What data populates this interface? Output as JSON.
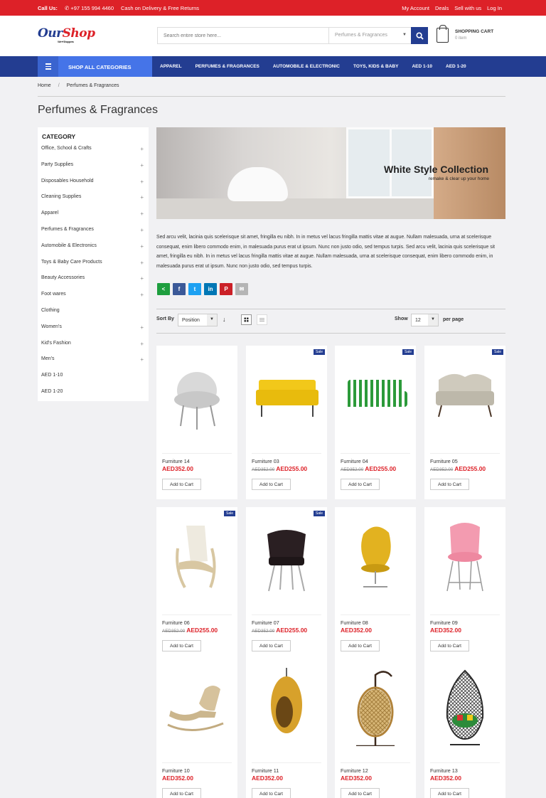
{
  "topbar": {
    "call_label": "Call Us:",
    "phone": "+97 155 994 4460",
    "promo": "Cash on Delivery & Free Returns",
    "links": [
      "My Account",
      "Deals",
      "Sell with us",
      "Log In"
    ]
  },
  "logo": {
    "brand_a": "Our",
    "brand_b": "Shop",
    "tagline": "We ♥ Shoppers"
  },
  "search": {
    "placeholder": "Search entire store here...",
    "category": "Perfumes & Fragrances"
  },
  "cart": {
    "title": "SHOPPING CART",
    "count": "0 item"
  },
  "nav": {
    "all_label": "SHOP ALL CATEGORIES",
    "items": [
      "APPAREL",
      "PERFUMES & FRAGRANCES",
      "AUTOMOBILE & ELECTRONIC",
      "TOYS, KIDS & BABY",
      "AED 1-10",
      "AED 1-20"
    ]
  },
  "breadcrumb": {
    "home": "Home",
    "sep": "/",
    "current": "Perfumes & Fragrances"
  },
  "page_title": "Perfumes & Fragrances",
  "sidebar": {
    "title": "CATEGORY",
    "items": [
      {
        "label": "Office, School & Crafts",
        "plus": "+"
      },
      {
        "label": "Party Supplies",
        "plus": "+"
      },
      {
        "label": "Disposables Household",
        "plus": "+"
      },
      {
        "label": "Cleaning Supplies",
        "plus": "+"
      },
      {
        "label": "Apparel",
        "plus": "+"
      },
      {
        "label": "Perfumes & Fragrances",
        "plus": "+"
      },
      {
        "label": "Automobile & Electronics",
        "plus": "+"
      },
      {
        "label": "Toys & Baby Care Products",
        "plus": "+"
      },
      {
        "label": "Beauty Accessories",
        "plus": "+"
      },
      {
        "label": "Foot wares",
        "plus": "+"
      },
      {
        "label": "Clothing",
        "plus": ""
      },
      {
        "label": "Women's",
        "plus": "+"
      },
      {
        "label": "Kid's Fashion",
        "plus": "+"
      },
      {
        "label": "Men's",
        "plus": "+"
      },
      {
        "label": "AED 1-10",
        "plus": ""
      },
      {
        "label": "AED 1-20",
        "plus": ""
      }
    ]
  },
  "banner": {
    "heading": "White Style Collection",
    "sub": "remake & clear up your home"
  },
  "description": "Sed arcu velit, lacinia quis scelerisque sit amet, fringilla eu nibh. In in metus vel lacus fringilla mattis vitae at augue. Nullam malesuada, urna at scelerisque consequat, enim libero commodo enim, in malesuada purus erat ut ipsum. Nunc non justo odio, sed tempus turpis. Sed arcu velit, lacinia quis scelerisque sit amet, fringilla eu nibh. In in metus vel lacus fringilla mattis vitae at augue. Nullam malesuada, urna at scelerisque consequat, enim libero commodo enim, in malesuada purus erat ut ipsum. Nunc non justo odio, sed tempus turpis.",
  "share": [
    {
      "icon": "share-icon",
      "glyph": "<",
      "color": "#1e9e3e"
    },
    {
      "icon": "facebook-icon",
      "glyph": "f",
      "color": "#3b5998"
    },
    {
      "icon": "twitter-icon",
      "glyph": "t",
      "color": "#1da1f2"
    },
    {
      "icon": "linkedin-icon",
      "glyph": "in",
      "color": "#0077b5"
    },
    {
      "icon": "pinterest-icon",
      "glyph": "P",
      "color": "#cb2027"
    },
    {
      "icon": "email-icon",
      "glyph": "✉",
      "color": "#b5b5b5"
    }
  ],
  "toolbar": {
    "sort_label": "Sort By",
    "sort_value": "Position",
    "show_label": "Show",
    "show_value": "12",
    "per_page": "per page"
  },
  "add_to_cart": "Add to Cart",
  "sale_label": "Sale",
  "products": [
    {
      "name": "Furniture 14",
      "old": "",
      "price": "AED352.00",
      "sale": false,
      "kind": "armchair-grey"
    },
    {
      "name": "Furniture 03",
      "old": "AED352.00",
      "price": "AED255.00",
      "sale": true,
      "kind": "sofa-yellow"
    },
    {
      "name": "Furniture 04",
      "old": "AED352.00",
      "price": "AED255.00",
      "sale": true,
      "kind": "sofa-striped"
    },
    {
      "name": "Furniture 05",
      "old": "AED352.00",
      "price": "AED255.00",
      "sale": true,
      "kind": "sofa-beige"
    },
    {
      "name": "Furniture 06",
      "old": "AED352.00",
      "price": "AED255.00",
      "sale": true,
      "kind": "lounge-chair"
    },
    {
      "name": "Furniture 07",
      "old": "AED352.00",
      "price": "AED255.00",
      "sale": true,
      "kind": "chair-black"
    },
    {
      "name": "Furniture 08",
      "old": "",
      "price": "AED352.00",
      "sale": false,
      "kind": "egg-chair"
    },
    {
      "name": "Furniture 09",
      "old": "",
      "price": "AED352.00",
      "sale": false,
      "kind": "chair-pink"
    },
    {
      "name": "Furniture 10",
      "old": "",
      "price": "AED352.00",
      "sale": false,
      "kind": "rocker"
    },
    {
      "name": "Furniture 11",
      "old": "",
      "price": "AED352.00",
      "sale": false,
      "kind": "hanging-pod"
    },
    {
      "name": "Furniture 12",
      "old": "",
      "price": "AED352.00",
      "sale": false,
      "kind": "hanging-egg"
    },
    {
      "name": "Furniture 13",
      "old": "",
      "price": "AED352.00",
      "sale": false,
      "kind": "hanging-cocoon"
    }
  ]
}
